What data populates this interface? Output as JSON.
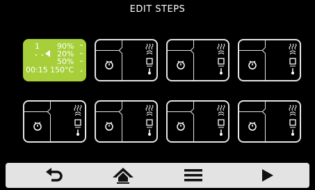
{
  "header": {
    "title": "EDIT STEPS"
  },
  "active_step": {
    "cycles": "1",
    "humidity": "90%",
    "fan": "20%",
    "power": "50%",
    "time": "00:15",
    "temperature": "150°C"
  },
  "colors": {
    "accent": "#a6cf3a",
    "background": "#000000",
    "bar": "#e3e3e3"
  },
  "toolbar": {
    "buttons": [
      {
        "icon": "back-arrow-icon"
      },
      {
        "icon": "home-icon"
      },
      {
        "icon": "menu-icon"
      },
      {
        "icon": "play-icon"
      }
    ]
  }
}
